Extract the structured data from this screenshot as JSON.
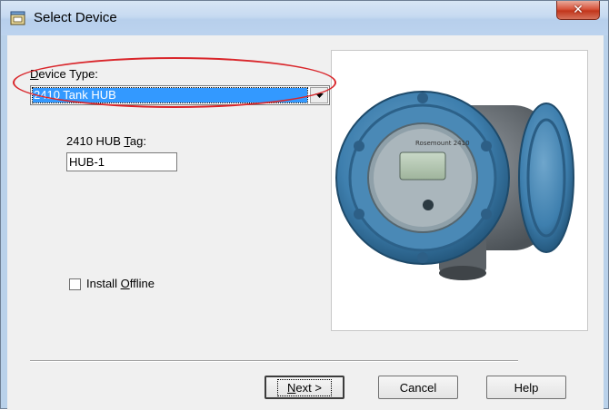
{
  "window": {
    "title": "Select Device"
  },
  "device_type": {
    "label_prefix": "",
    "label_mnemonic": "D",
    "label_rest": "evice Type:",
    "selected": "2410 Tank HUB"
  },
  "hub_tag": {
    "label_prefix": "2410 HUB ",
    "label_mnemonic": "T",
    "label_rest": "ag:",
    "value": "HUB-1"
  },
  "install_offline": {
    "label_prefix": "Install ",
    "label_mnemonic": "O",
    "label_rest": "ffline",
    "checked": false
  },
  "device_image": {
    "caption": "Rosemount 2410"
  },
  "buttons": {
    "next_mnemonic": "N",
    "next_rest": "ext >",
    "cancel": "Cancel",
    "help": "Help"
  },
  "colors": {
    "selection": "#3399ff",
    "highlight_ring": "#d9262b",
    "device_blue": "#3e7fae"
  },
  "icons": {
    "app": "device-window-icon",
    "close": "close-icon",
    "dropdown": "chevron-down-icon"
  }
}
